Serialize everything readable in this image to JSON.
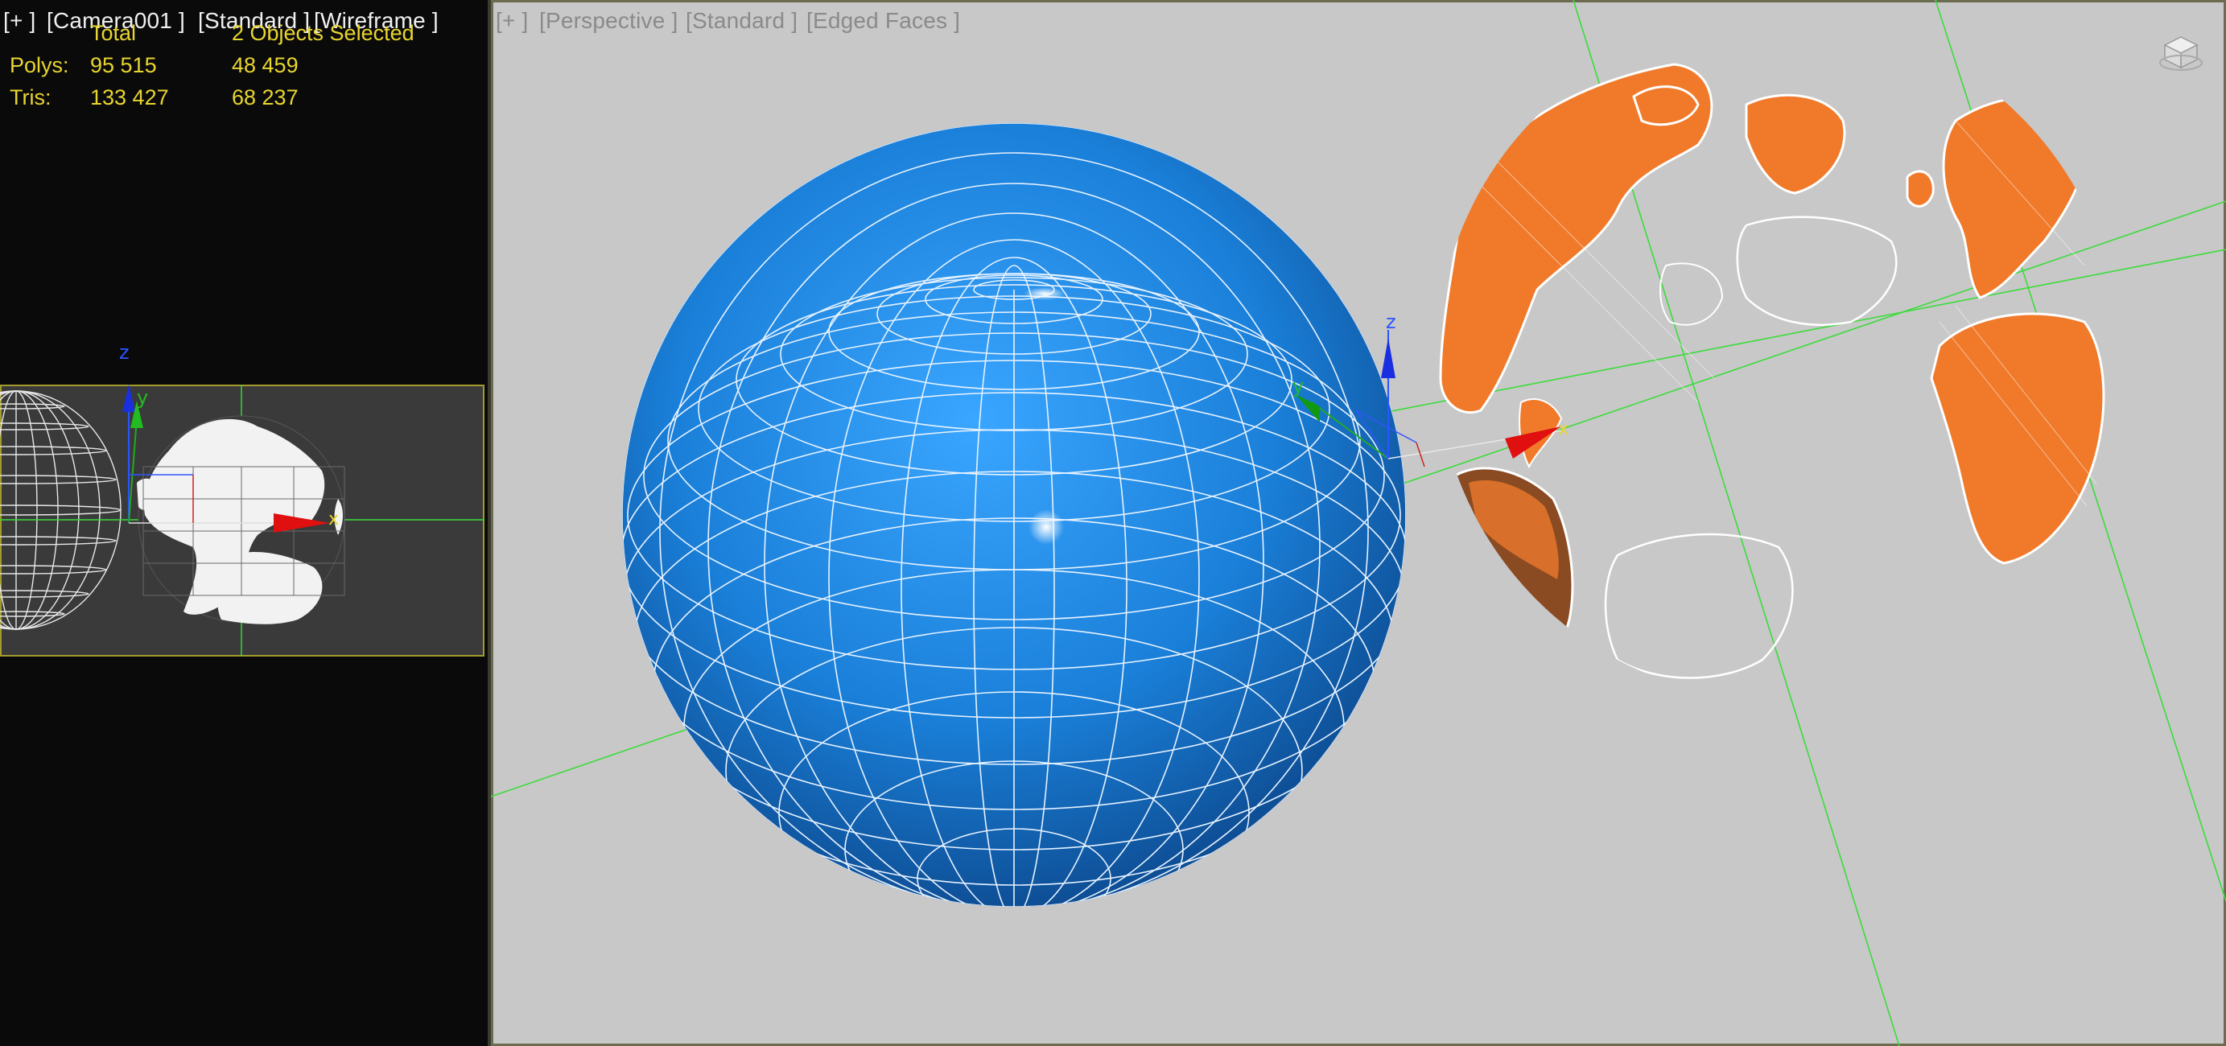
{
  "left_viewport": {
    "label_plus": "[+ ]",
    "label_camera": "[Camera001 ]",
    "label_standard": "[Standard ]",
    "label_shading": "[Wireframe ]",
    "stats": {
      "header_total": "Total",
      "header_selected": "2 Objects Selected",
      "polys_label": "Polys:",
      "polys_total": "95 515",
      "polys_selected": "48 459",
      "tris_label": "Tris:",
      "tris_total": "133 427",
      "tris_selected": "68 237"
    },
    "gizmo_axes": {
      "z": "z",
      "y": "y",
      "x": "x"
    }
  },
  "right_viewport": {
    "label_plus": "[+ ]",
    "label_view": "[Perspective ]",
    "label_standard": "[Standard ]",
    "label_shading": "[Edged Faces ]",
    "gizmo_axes": {
      "z": "z",
      "y": "y",
      "x": "x"
    }
  },
  "colors": {
    "sphere_blue": "#1a7fd8",
    "continent_orange": "#f07a2a",
    "stats_yellow": "#e8d530",
    "viewport_gray": "#c8c8c8",
    "grid_green": "#3bdc3b"
  }
}
